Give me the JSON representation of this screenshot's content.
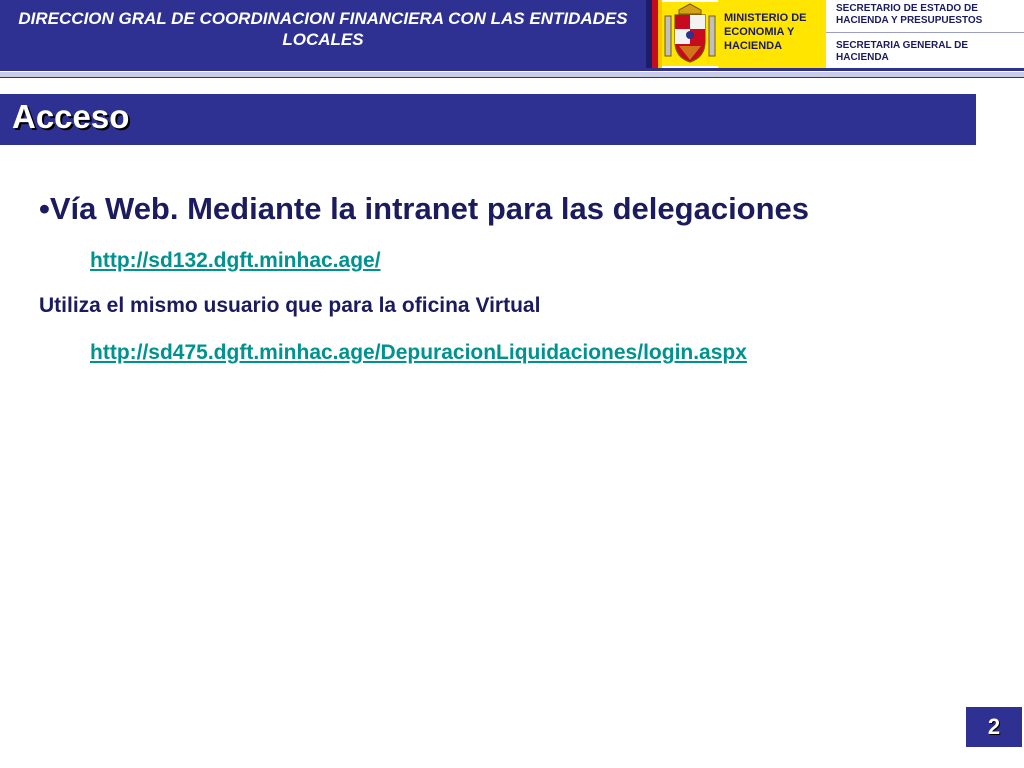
{
  "header": {
    "org_title": "DIRECCION GRAL DE COORDINACION FINANCIERA CON LAS ENTIDADES LOCALES",
    "ministerio": [
      "MINISTERIO DE",
      "ECONOMIA Y",
      "HACIENDA"
    ],
    "secretario": [
      "SECRETARIO DE ESTADO DE",
      "HACIENDA Y PRESUPUESTOS"
    ],
    "secretaria": [
      "SECRETARIA GENERAL DE",
      "HACIENDA"
    ],
    "shield_icon": "coat-of-arms-icon",
    "colors": {
      "navy": "#2e3192",
      "yellow": "#ffe500",
      "red": "#c60b1e"
    }
  },
  "slide": {
    "title": "Acceso",
    "bullet": "•Vía Web. Mediante la intranet para las delegaciones",
    "link1": "http://sd132.dgft.minhac.age/",
    "note": "Utiliza el mismo usuario que para la oficina Virtual",
    "link2": "http://sd475.dgft.minhac.age/DepuracionLiquidaciones/login.aspx",
    "page_number": "2",
    "colors": {
      "link": "#00928f",
      "text": "#1b1b5e"
    }
  }
}
